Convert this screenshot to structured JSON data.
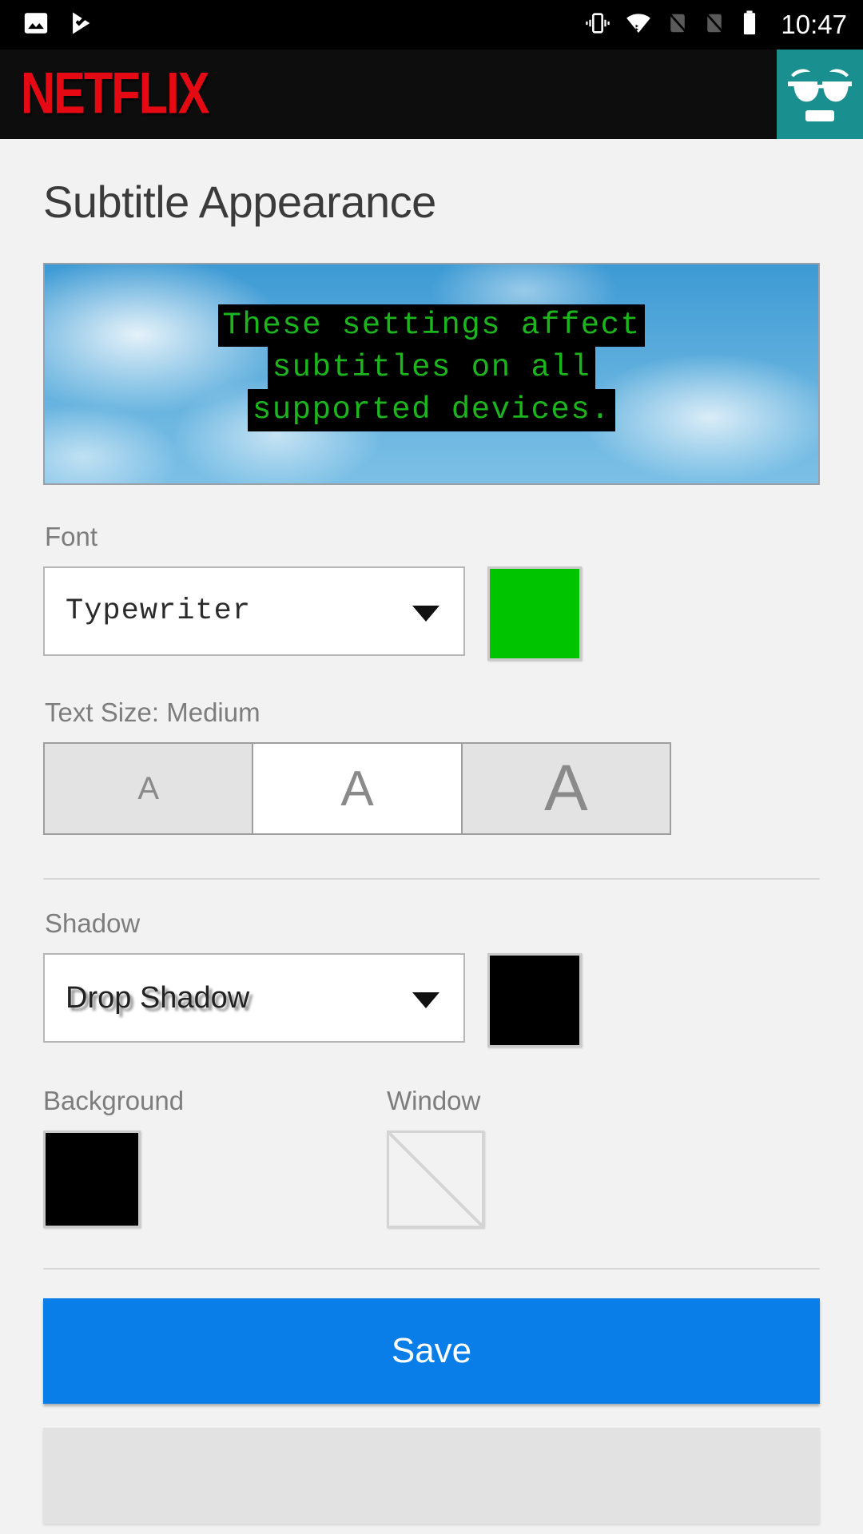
{
  "status_bar": {
    "time": "10:47",
    "left_icons": [
      "image-icon",
      "play-update-icon"
    ],
    "right_icons": [
      "vibrate-icon",
      "wifi-icon",
      "sim-off-icon",
      "sim-off-icon",
      "battery-full-icon"
    ]
  },
  "app_bar": {
    "brand": "NETFLIX",
    "brand_color": "#e50914",
    "avatar_icon": "sunglasses-face-avatar",
    "avatar_color": "#1a8f8f"
  },
  "page": {
    "title": "Subtitle Appearance"
  },
  "preview": {
    "lines": [
      "These settings affect",
      "subtitles on all",
      "supported devices."
    ],
    "text_color": "#1db51d",
    "background_color": "#000000",
    "scene": "blue-sky-clouds"
  },
  "font_section": {
    "label": "Font",
    "value": "Typewriter",
    "color_swatch": "#00c400"
  },
  "text_size_section": {
    "label": "Text Size: Medium",
    "options": [
      {
        "glyph": "A",
        "size_name": "Small",
        "selected": false
      },
      {
        "glyph": "A",
        "size_name": "Medium",
        "selected": true
      },
      {
        "glyph": "A",
        "size_name": "Large",
        "selected": false
      }
    ]
  },
  "shadow_section": {
    "label": "Shadow",
    "value": "Drop Shadow",
    "color_swatch": "#000000"
  },
  "background_section": {
    "label": "Background",
    "color_swatch": "#000000"
  },
  "window_section": {
    "label": "Window",
    "color_swatch": "none"
  },
  "actions": {
    "save_label": "Save",
    "save_color": "#0a7ee8"
  }
}
